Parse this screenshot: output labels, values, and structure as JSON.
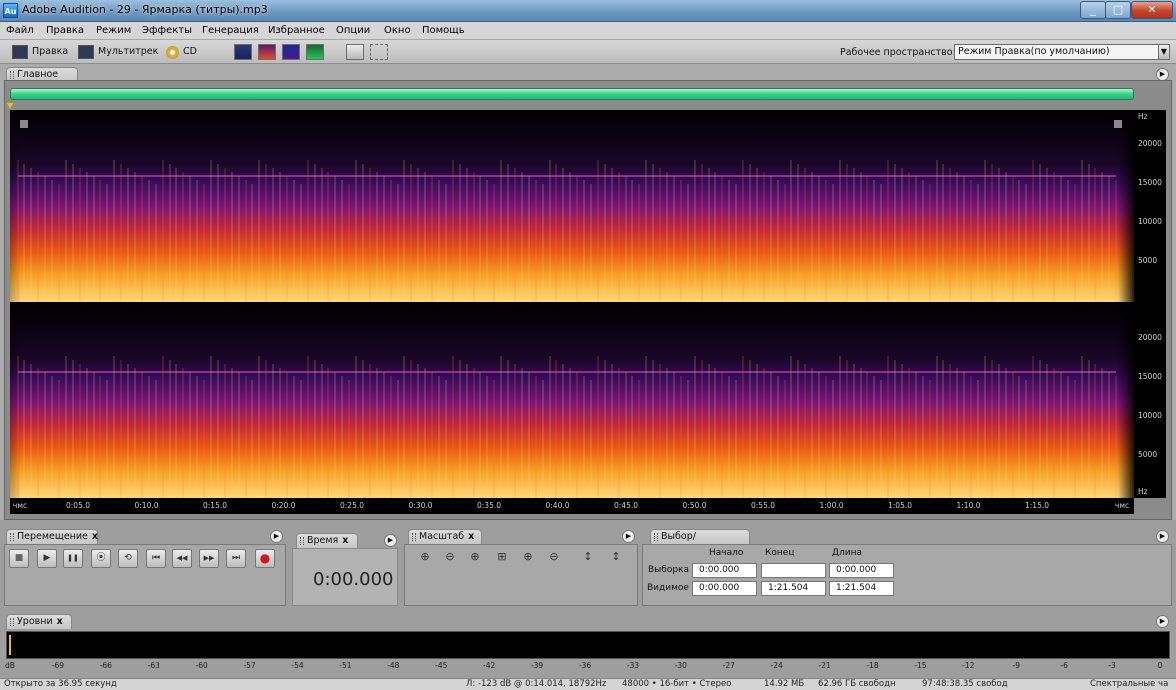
{
  "window": {
    "title": "Adobe Audition - 29 - Ярмарка (титры).mp3",
    "app_icon": "Au",
    "minimize": "_",
    "maximize": "□",
    "close": "✕"
  },
  "menu": [
    "Файл",
    "Правка",
    "Режим",
    "Эффекты",
    "Генерация",
    "Избранное",
    "Опции",
    "Окно",
    "Помощь"
  ],
  "toolbar": {
    "edit_label": "Правка",
    "multitrack_label": "Мультитрек",
    "cd_label": "CD",
    "workspace_label": "Рабочее пространство:",
    "workspace_value": "Режим Правка(по умолчанию)",
    "dropdown_arrow": "▼"
  },
  "main_panel": {
    "tab_label": "Главное",
    "menu_glyph": "▶",
    "marker": "▼"
  },
  "frequency_axis": {
    "unit": "Hz",
    "labels": [
      "20000",
      "15000",
      "10000",
      "5000"
    ]
  },
  "timeline": {
    "start": "чмс",
    "end": "чмс",
    "ticks": [
      "0:05.0",
      "0:10.0",
      "0:15.0",
      "0:20.0",
      "0:25.0",
      "0:30.0",
      "0:35.0",
      "0:40.0",
      "0:45.0",
      "0:50.0",
      "0:55.0",
      "1:00.0",
      "1:05.0",
      "1:10.0",
      "1:15.0"
    ]
  },
  "transport": {
    "tab_label": "Перемещение",
    "close": "x",
    "buttons": [
      "■",
      "▶",
      "❚❚",
      "⦿",
      "⟲",
      "⏮",
      "◀◀",
      "▶▶",
      "⏭",
      "●"
    ]
  },
  "time_panel": {
    "tab_label": "Время",
    "close": "x",
    "value": "0:00.000"
  },
  "zoom_panel": {
    "tab_label": "Масштаб",
    "close": "x",
    "buttons": [
      "⊕",
      "⊖",
      "⊕",
      "⊞",
      "⊕",
      "⊖",
      "↕",
      "↕"
    ]
  },
  "selection_panel": {
    "tab_label": "Выбор/Видимое",
    "close": "x",
    "col_start": "Начало",
    "col_end": "Конец",
    "col_length": "Длина",
    "row_selection": "Выборка",
    "row_view": "Видимое",
    "sel_start": "0:00.000",
    "sel_end": "",
    "sel_length": "0:00.000",
    "view_start": "0:00.000",
    "view_end": "1:21.504",
    "view_length": "1:21.504"
  },
  "levels_panel": {
    "tab_label": "Уровни",
    "close": "x",
    "scale": [
      "dB",
      "-69",
      "-66",
      "-63",
      "-60",
      "-57",
      "-54",
      "-51",
      "-48",
      "-45",
      "-42",
      "-39",
      "-36",
      "-33",
      "-30",
      "-27",
      "-24",
      "-21",
      "-18",
      "-15",
      "-12",
      "-9",
      "-6",
      "-3",
      "0"
    ]
  },
  "status": {
    "opened": "Открыто за 36.95 секунд",
    "cursor": "Л: -123 dB @  0:14.014, 18792Hz",
    "format": "48000 • 16-бит • Стерео",
    "size": "14.92 МБ",
    "free_space": "62.96 ГБ свободн",
    "free_time": "97:48:38.35 свобод",
    "view_mode": "Спектральные ча"
  },
  "colors": {
    "overview_bar": "#22b872",
    "spectral_line": "#b03a9c",
    "record_button": "#d0181a"
  }
}
